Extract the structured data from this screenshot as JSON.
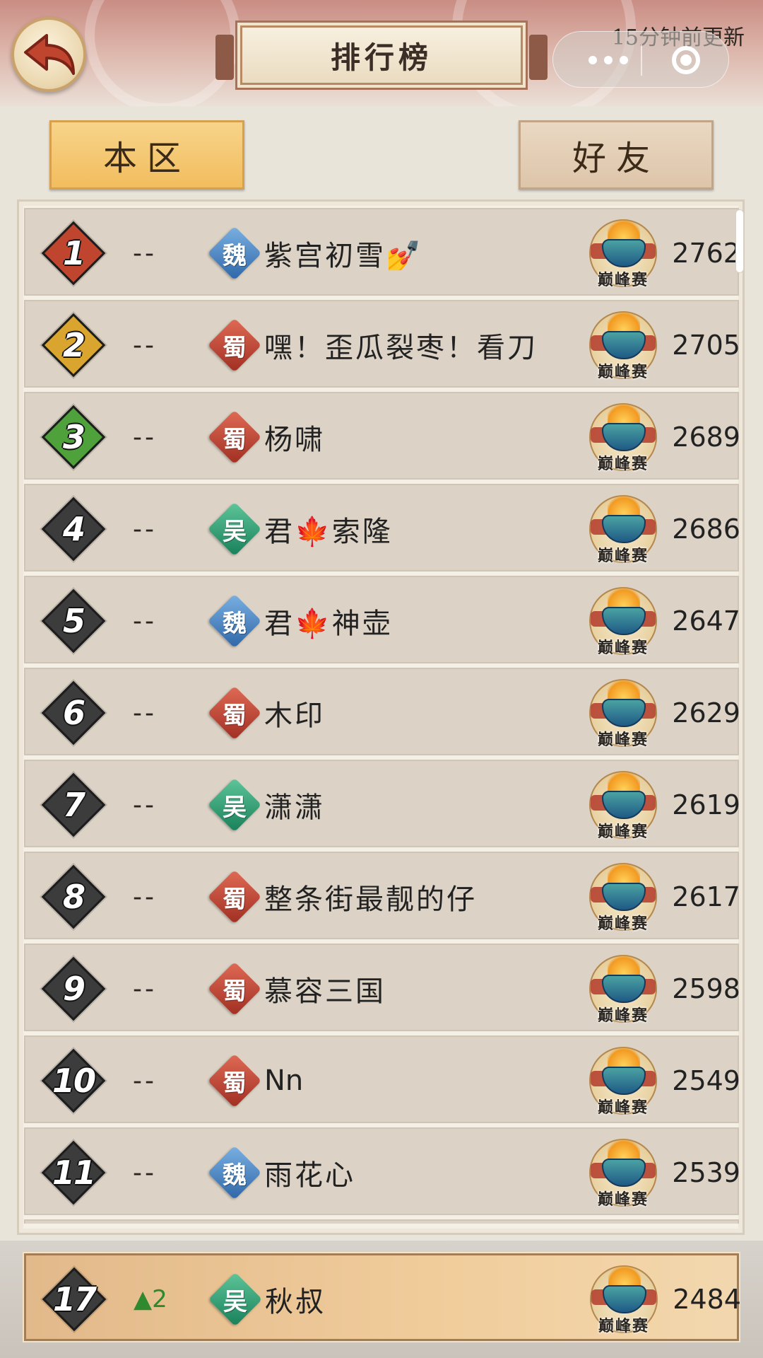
{
  "header": {
    "title": "排行榜",
    "update_text": "15分钟前更新"
  },
  "tabs": [
    {
      "label": "本区",
      "active": true
    },
    {
      "label": "好友",
      "active": false
    }
  ],
  "badge_label": "巅峰赛",
  "rows": [
    {
      "rank": "1",
      "change": "--",
      "faction": "魏",
      "faction_key": "wei",
      "name": "紫宫初雪💅",
      "score": "2762",
      "rank_color": "#c0452f"
    },
    {
      "rank": "2",
      "change": "--",
      "faction": "蜀",
      "faction_key": "shu",
      "name": "嘿！歪瓜裂枣！看刀",
      "score": "2705",
      "rank_color": "#d9a52e"
    },
    {
      "rank": "3",
      "change": "--",
      "faction": "蜀",
      "faction_key": "shu",
      "name": "杨啸",
      "score": "2689",
      "rank_color": "#4fa13b"
    },
    {
      "rank": "4",
      "change": "--",
      "faction": "吴",
      "faction_key": "wu",
      "name": "君🍁索隆",
      "score": "2686",
      "rank_color": "#3c3c3c"
    },
    {
      "rank": "5",
      "change": "--",
      "faction": "魏",
      "faction_key": "wei",
      "name": "君🍁神壶",
      "score": "2647",
      "rank_color": "#3c3c3c"
    },
    {
      "rank": "6",
      "change": "--",
      "faction": "蜀",
      "faction_key": "shu",
      "name": "木印",
      "score": "2629",
      "rank_color": "#3c3c3c"
    },
    {
      "rank": "7",
      "change": "--",
      "faction": "吴",
      "faction_key": "wu",
      "name": "潇潇",
      "score": "2619",
      "rank_color": "#3c3c3c"
    },
    {
      "rank": "8",
      "change": "--",
      "faction": "蜀",
      "faction_key": "shu",
      "name": "整条街最靓的仔",
      "score": "2617",
      "rank_color": "#3c3c3c"
    },
    {
      "rank": "9",
      "change": "--",
      "faction": "蜀",
      "faction_key": "shu",
      "name": "慕容三国",
      "score": "2598",
      "rank_color": "#3c3c3c"
    },
    {
      "rank": "10",
      "change": "--",
      "faction": "蜀",
      "faction_key": "shu",
      "name": "Nn",
      "score": "2549",
      "rank_color": "#3c3c3c"
    },
    {
      "rank": "11",
      "change": "--",
      "faction": "魏",
      "faction_key": "wei",
      "name": "雨花心",
      "score": "2539",
      "rank_color": "#3c3c3c"
    }
  ],
  "self_row": {
    "rank": "17",
    "change_arrow": "▲",
    "change": "2",
    "faction": "吴",
    "faction_key": "wu",
    "name": "秋叔",
    "score": "2484",
    "rank_color": "#3c3c3c"
  },
  "icons": {
    "back": "back-arrow-icon",
    "more": "more-dots-icon",
    "close": "mini-program-close-icon"
  }
}
